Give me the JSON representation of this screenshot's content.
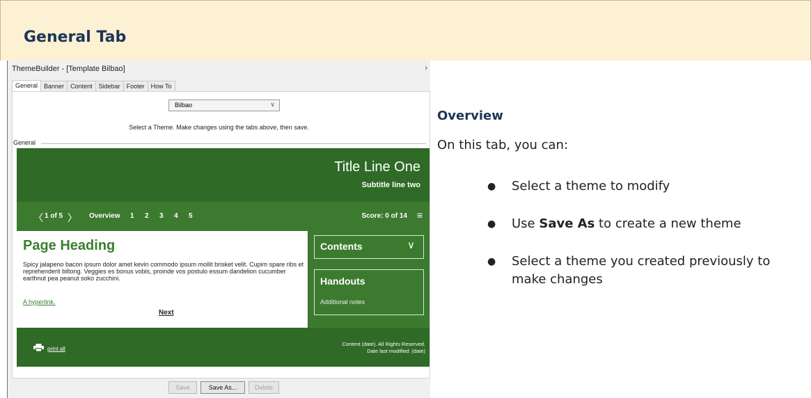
{
  "banner": {
    "title": "General Tab"
  },
  "app": {
    "window_title": "ThemeBuilder - [Template Bilbao]",
    "close_glyph": "›",
    "tabs": [
      "General",
      "Banner",
      "Content",
      "Sidebar",
      "Footer",
      "How To"
    ],
    "active_tab": "General",
    "theme_select": {
      "value": "Bilbao",
      "chevron": "∨"
    },
    "hint": "Select a Theme. Make changes using the tabs above, then save.",
    "group_label": "General",
    "preview": {
      "title": "Title Line One",
      "subtitle": "Subtitle line two",
      "nav": {
        "prev": "〈",
        "count": "1 of 5",
        "next": "〉",
        "overview": "Overview",
        "pages": [
          "1",
          "2",
          "3",
          "4",
          "5"
        ],
        "score": "Score: 0 of 14",
        "menu": "≡"
      },
      "heading": "Page Heading",
      "body": "Spicy jalapeno bacon ipsum dolor amet kevin commodo ipsum mollit brisket velit. Cupim spare ribs et reprehenderit biltong. Veggies es bonus vobis, proinde vos postulo essum dandelion cucumber earthnut pea peanut soko zucchini.",
      "link": "A hyperlink.",
      "next_link": "Next",
      "sidebar": {
        "contents": "Contents",
        "contents_chevron": "∨",
        "handouts": "Handouts",
        "handouts_note": "Additional notes"
      },
      "footer": {
        "print": "print all",
        "copyright": "Content (date). All Rights Reserved.",
        "modified": "Date last modified: (date)"
      }
    },
    "buttons": {
      "save": "Save",
      "save_as": "Save As...",
      "delete": "Delete"
    }
  },
  "overview": {
    "heading": "Overview",
    "lead": "On this tab, you can:",
    "items": [
      {
        "text": "Select a theme to modify"
      },
      {
        "pre": "Use ",
        "bold": "Save As",
        "post": " to create a new theme"
      },
      {
        "text": "Select a theme you created previously to make changes"
      }
    ]
  },
  "colors": {
    "banner_bg": "#fcf1d3",
    "heading_navy": "#1d3557",
    "preview_dark_green": "#2f6a27",
    "preview_green": "#3c7a30",
    "heading_green": "#3a7f2f"
  }
}
